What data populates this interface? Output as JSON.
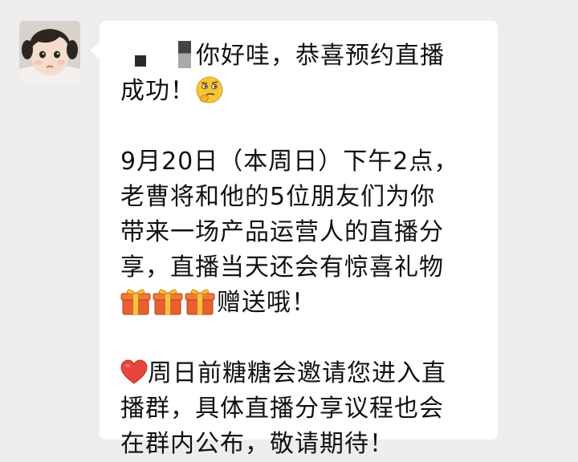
{
  "contact": {
    "avatar_icon": "girl-avatar-photo-icon"
  },
  "message": {
    "p1": {
      "line1_text": "你好哇，恭喜预约直播",
      "line2_text": "成功！",
      "emoji": "thinking-face-emoji-icon"
    },
    "p2": {
      "line1": "9月20日（本周日）下午2点，",
      "line2": "老曹将和他的5位朋友们为你",
      "line3": "带来一场产品运营人的直播分",
      "line4": "享，直播当天还会有惊喜礼物",
      "line5_text": "赠送哦！",
      "gift_icons": [
        "gift-icon",
        "gift-icon",
        "gift-icon"
      ]
    },
    "p3": {
      "heart_icon": "red-heart-icon",
      "line1_text": "周日前糖糖会邀请您进入直",
      "line2": "播群，具体直播分享议程也会",
      "line3": "在群内公布，敬请期待！"
    }
  },
  "colors": {
    "background": "#ededed",
    "bubble": "#ffffff",
    "text": "#111111",
    "heart": "#e8453c",
    "gift": "#e8602c"
  }
}
